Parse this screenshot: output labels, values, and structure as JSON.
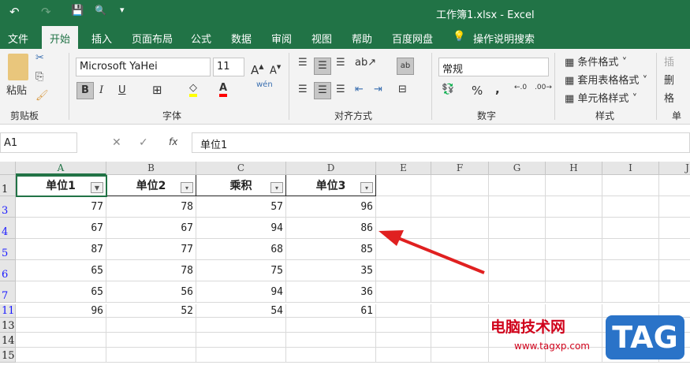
{
  "window": {
    "title": "工作簿1.xlsx  -  Excel"
  },
  "qat": {
    "undo": "↶",
    "redo": "↷",
    "save": "💾",
    "preview": "🔍",
    "more": "▾"
  },
  "tabs": [
    "文件",
    "开始",
    "插入",
    "页面布局",
    "公式",
    "数据",
    "审阅",
    "视图",
    "帮助",
    "百度网盘"
  ],
  "active_tab": "开始",
  "tell_me": "操作说明搜索",
  "ribbon": {
    "clipboard": {
      "label": "剪贴板",
      "paste": "粘贴"
    },
    "font": {
      "label": "字体",
      "font_name": "Microsoft YaHei",
      "font_size": "11",
      "bold": "B",
      "italic": "I",
      "underline": "U",
      "fill_color": "#ffff00",
      "font_color": "#ff0000"
    },
    "alignment": {
      "label": "对齐方式"
    },
    "number": {
      "label": "数字",
      "format": "常规",
      "percent": "%",
      "comma": ","
    },
    "styles": {
      "label": "样式",
      "conditional": "条件格式",
      "table": "套用表格格式",
      "cell_styles": "单元格样式"
    },
    "cells": {
      "label": "单元",
      "insert": "插",
      "delete": "删",
      "format": "格"
    }
  },
  "formula_bar": {
    "name_box": "A1",
    "fx": "fx",
    "content": "单位1"
  },
  "columns": [
    "A",
    "B",
    "C",
    "D",
    "E",
    "F",
    "G",
    "H",
    "I",
    "J"
  ],
  "rows": [
    {
      "num": "1",
      "filtered": false,
      "cells": [
        "单位1",
        "单位2",
        "乘积",
        "单位3"
      ],
      "header": true
    },
    {
      "num": "3",
      "filtered": true,
      "cells": [
        "77",
        "78",
        "57",
        "96"
      ]
    },
    {
      "num": "4",
      "filtered": true,
      "cells": [
        "67",
        "67",
        "94",
        "86"
      ]
    },
    {
      "num": "5",
      "filtered": true,
      "cells": [
        "87",
        "77",
        "68",
        "85"
      ]
    },
    {
      "num": "6",
      "filtered": true,
      "cells": [
        "65",
        "78",
        "75",
        "35"
      ]
    },
    {
      "num": "7",
      "filtered": true,
      "cells": [
        "65",
        "56",
        "94",
        "36"
      ]
    },
    {
      "num": "11",
      "filtered": true,
      "cells": [
        "96",
        "52",
        "54",
        "61"
      ]
    },
    {
      "num": "13",
      "filtered": false,
      "cells": [
        "",
        "",
        "",
        ""
      ]
    },
    {
      "num": "14",
      "filtered": false,
      "cells": [
        "",
        "",
        "",
        ""
      ]
    },
    {
      "num": "15",
      "filtered": false,
      "cells": [
        "",
        "",
        "",
        ""
      ]
    }
  ],
  "watermark": {
    "site": "电脑技术网",
    "url": "www.tagxp.com",
    "logo": "TAG"
  },
  "colors": {
    "accent": "#217346",
    "arrow": "#e02020",
    "filtered_row": "#1a1aff"
  }
}
